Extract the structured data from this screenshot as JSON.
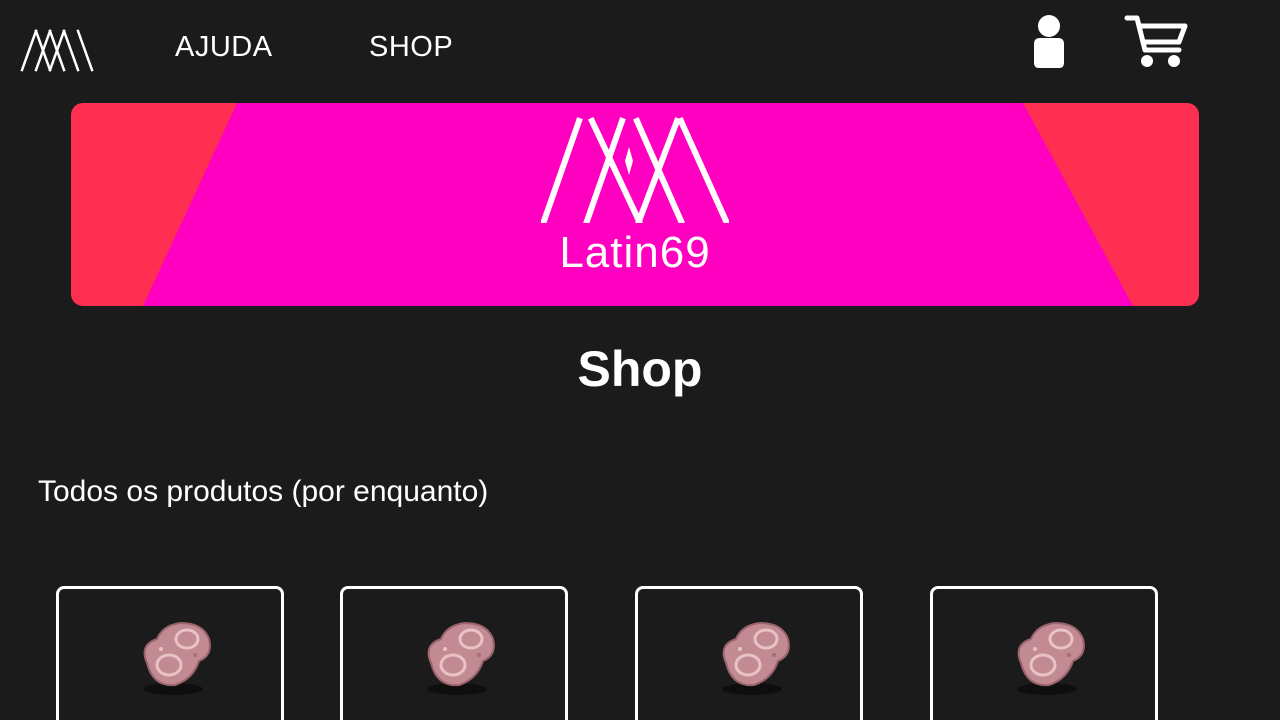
{
  "nav": {
    "logo_icon": "latin69-monogram-icon",
    "links": [
      "AJUDA",
      "SHOP"
    ],
    "user_icon": "user-icon",
    "cart_icon": "shopping-cart-icon"
  },
  "banner": {
    "brand": "Latin69",
    "logo_icon": "latin69-monogram-icon",
    "colors": {
      "primary": "#ff00c0",
      "secondary": "#ff2f52"
    }
  },
  "main": {
    "title": "Shop",
    "section_label": "Todos os produtos (por enquanto)",
    "products": [
      {
        "image_icon": "pink-pill-product-image"
      },
      {
        "image_icon": "pink-pill-product-image"
      },
      {
        "image_icon": "pink-pill-product-image"
      },
      {
        "image_icon": "pink-pill-product-image"
      }
    ]
  },
  "theme": {
    "background": "#1b1b1b",
    "text": "#ffffff"
  }
}
